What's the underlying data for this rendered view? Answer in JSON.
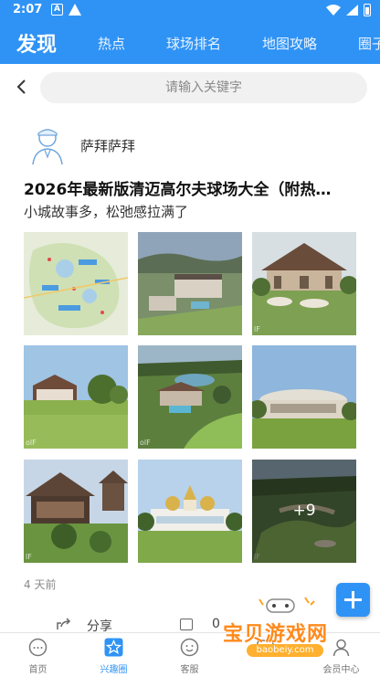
{
  "status_bar": {
    "time": "2:07",
    "left_icons": [
      "notification-a-icon",
      "warning-icon"
    ],
    "right_icons": [
      "wifi-icon",
      "signal-icon",
      "battery-icon"
    ],
    "a_glyph": "A"
  },
  "header": {
    "title": "发现",
    "tabs": [
      "热点",
      "球场排名",
      "地图攻略",
      "圈子"
    ]
  },
  "search": {
    "placeholder": "请输入关键字"
  },
  "post": {
    "author": "萨拜萨拜",
    "title": "2026年最新版清迈高尔夫球场大全（附热…",
    "subtitle": "小城故事多，松弛感拉满了",
    "photos": [
      {
        "name": "golf-course-map-photo",
        "wm": ""
      },
      {
        "name": "resort-aerial-photo",
        "wm": ""
      },
      {
        "name": "thai-clubhouse-photo",
        "wm": "lF"
      },
      {
        "name": "green-lawn-clubhouse-photo",
        "wm": "olF"
      },
      {
        "name": "lake-course-aerial-photo",
        "wm": "olF"
      },
      {
        "name": "round-clubhouse-photo",
        "wm": ""
      },
      {
        "name": "wooden-pavilion-photo",
        "wm": "lF"
      },
      {
        "name": "white-palace-clubhouse-photo",
        "wm": ""
      },
      {
        "name": "course-overview-photo",
        "wm": "lF"
      }
    ],
    "more_count": "+9",
    "time_ago": "4 天前",
    "share_label": "分享",
    "comment_count": "0"
  },
  "bottom_nav": [
    {
      "label": "首页",
      "icon": "home-icon",
      "active": false
    },
    {
      "label": "兴趣圈",
      "icon": "star-icon",
      "active": true
    },
    {
      "label": "客服",
      "icon": "chat-icon",
      "active": false
    },
    {
      "label": "",
      "icon": "tool-icon",
      "active": false
    },
    {
      "label": "会员中心",
      "icon": "profile-icon",
      "active": false
    }
  ],
  "brand_watermark": {
    "cn": "宝贝游戏网",
    "url": "baobeiy.com"
  },
  "colors": {
    "primary": "#2f93f5",
    "brand_orange": "#ff8a1c"
  }
}
